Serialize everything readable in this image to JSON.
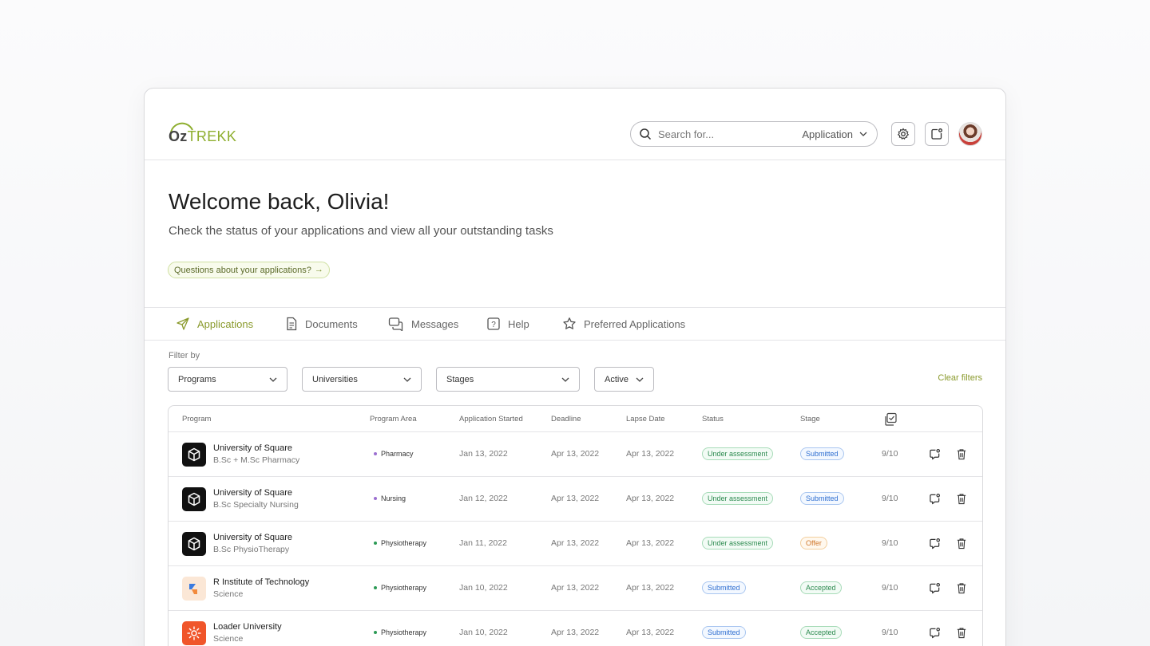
{
  "brand": {
    "oz": "Oz",
    "trekk": "TREKK"
  },
  "search": {
    "placeholder": "Search for...",
    "scope": "Application"
  },
  "hero": {
    "title": "Welcome back, Olivia!",
    "subtitle": "Check the status of your applications and view all your outstanding tasks",
    "help_chip": "Questions about your applications?"
  },
  "tabs": [
    {
      "label": "Applications",
      "icon": "send-icon",
      "active": true
    },
    {
      "label": "Documents",
      "icon": "document-icon"
    },
    {
      "label": "Messages",
      "icon": "chat-icon"
    },
    {
      "label": "Help",
      "icon": "question-icon"
    },
    {
      "label": "Preferred Applications",
      "icon": "star-icon"
    }
  ],
  "filters": {
    "label": "Filter by",
    "programs": "Programs",
    "universities": "Universities",
    "stages": "Stages",
    "active": "Active",
    "clear": "Clear filters"
  },
  "table": {
    "headers": {
      "program": "Program",
      "area": "Program Area",
      "started": "Application Started",
      "deadline": "Deadline",
      "lapse": "Lapse Date",
      "status": "Status",
      "stage": "Stage"
    },
    "rows": [
      {
        "university": "University of Square",
        "program": "B.Sc + M.Sc  Pharmacy",
        "area": "Pharmacy",
        "area_color": "#9b6fd0",
        "started": "Jan 13, 2022",
        "deadline": "Apr 13, 2022",
        "lapse": "Apr 13, 2022",
        "status": "Under assessment",
        "stage": "Submitted",
        "progress": "9/10",
        "logo": "cube"
      },
      {
        "university": "University of Square",
        "program": "B.Sc Specialty Nursing",
        "area": "Nursing",
        "area_color": "#9b6fd0",
        "started": "Jan 12, 2022",
        "deadline": "Apr 13, 2022",
        "lapse": "Apr 13, 2022",
        "status": "Under assessment",
        "stage": "Submitted",
        "progress": "9/10",
        "logo": "cube"
      },
      {
        "university": "University of Square",
        "program": "B.Sc PhysioTherapy",
        "area": "Physiotherapy",
        "area_color": "#2c9a55",
        "started": "Jan 11, 2022",
        "deadline": "Apr 13, 2022",
        "lapse": "Apr 13, 2022",
        "status": "Under assessment",
        "stage": "Offer",
        "progress": "9/10",
        "logo": "cube"
      },
      {
        "university": "R Institute of Technology",
        "program": "Science",
        "area": "Physiotherapy",
        "area_color": "#2c9a55",
        "started": "Jan 10, 2022",
        "deadline": "Apr 13, 2022",
        "lapse": "Apr 13, 2022",
        "status": "Submitted",
        "stage": "Accepted",
        "progress": "9/10",
        "logo": "r-mark"
      },
      {
        "university": "Loader University",
        "program": "Science",
        "area": "Physiotherapy",
        "area_color": "#2c9a55",
        "started": "Jan 10, 2022",
        "deadline": "Apr 13, 2022",
        "lapse": "Apr 13, 2022",
        "status": "Submitted",
        "stage": "Accepted",
        "progress": "9/10",
        "logo": "sun"
      }
    ]
  },
  "colors": {
    "accent": "#8eae2e",
    "status_green": "#2c8a4f",
    "stage_blue": "#2f6fd1",
    "stage_orange": "#d0762a"
  }
}
